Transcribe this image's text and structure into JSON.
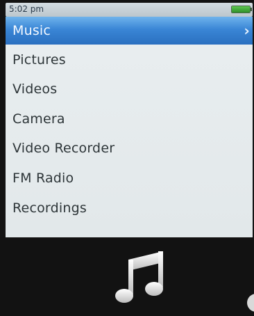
{
  "status": {
    "time": "5:02 pm"
  },
  "menu": {
    "items": [
      {
        "label": "Music",
        "selected": true
      },
      {
        "label": "Pictures",
        "selected": false
      },
      {
        "label": "Videos",
        "selected": false
      },
      {
        "label": "Camera",
        "selected": false
      },
      {
        "label": "Video Recorder",
        "selected": false
      },
      {
        "label": "FM Radio",
        "selected": false
      },
      {
        "label": "Recordings",
        "selected": false
      }
    ],
    "selected_chevron": "›"
  },
  "preview": {
    "icon": "music-note-icon"
  },
  "colors": {
    "highlight": "#3a86d6",
    "menu_background": "#e6ecee",
    "battery": "#3fae38",
    "screen_background": "#131313"
  }
}
